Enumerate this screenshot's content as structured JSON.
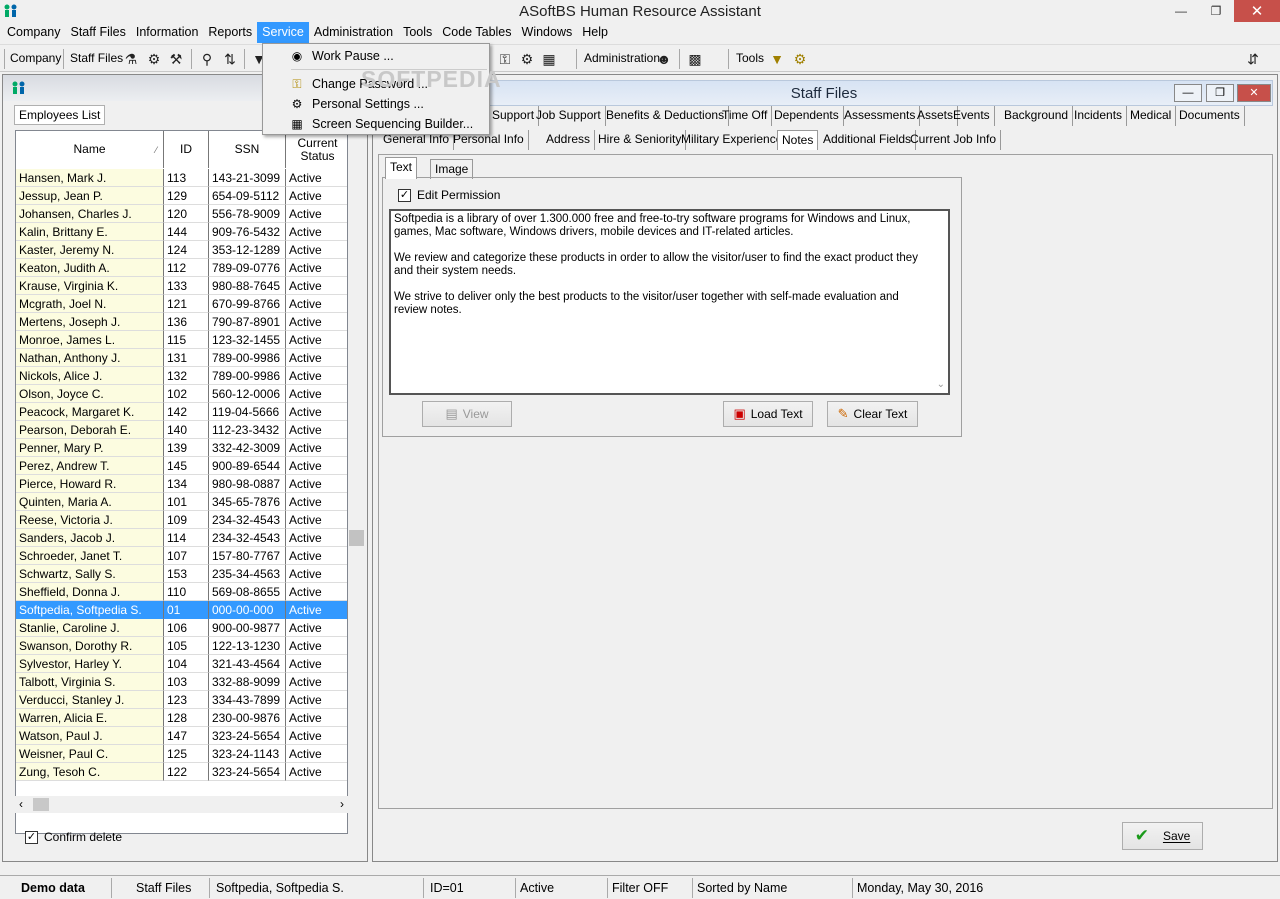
{
  "app": {
    "title": "ASoftBS Human Resource Assistant"
  },
  "menu": {
    "items": [
      "Company",
      "Staff Files",
      "Information",
      "Reports",
      "Service",
      "Administration",
      "Tools",
      "Code Tables",
      "Windows",
      "Help"
    ],
    "active": "Service"
  },
  "service_menu": {
    "items": [
      {
        "label": "Work Pause ...",
        "icon": "lock-icon"
      },
      {
        "label": "Change Password ...",
        "icon": "key-icon"
      },
      {
        "label": "Personal Settings ...",
        "icon": "settings-icon"
      },
      {
        "label": "Screen Sequencing Builder...",
        "icon": "sequence-icon"
      }
    ],
    "watermark": "SOFTPEDIA"
  },
  "toolbar": {
    "company": "Company",
    "staff_files": "Staff Files",
    "administration": "Administration",
    "tools": "Tools"
  },
  "left": {
    "tab": "Employees List",
    "columns": [
      "Name",
      "ID",
      "SSN",
      "Current Status"
    ],
    "confirm_delete": "Confirm delete",
    "confirm_checked": true,
    "selected_row": 24,
    "rows": [
      [
        "Hansen, Mark J.",
        "113",
        "143-21-3099",
        "Active"
      ],
      [
        "Jessup, Jean P.",
        "129",
        "654-09-5112",
        "Active"
      ],
      [
        "Johansen, Charles J.",
        "120",
        "556-78-9009",
        "Active"
      ],
      [
        "Kalin, Brittany E.",
        "144",
        "909-76-5432",
        "Active"
      ],
      [
        "Kaster, Jeremy N.",
        "124",
        "353-12-1289",
        "Active"
      ],
      [
        "Keaton, Judith A.",
        "112",
        "789-09-0776",
        "Active"
      ],
      [
        "Krause, Virginia K.",
        "133",
        "980-88-7645",
        "Active"
      ],
      [
        "Mcgrath, Joel N.",
        "121",
        "670-99-8766",
        "Active"
      ],
      [
        "Mertens, Joseph J.",
        "136",
        "790-87-8901",
        "Active"
      ],
      [
        "Monroe, James L.",
        "115",
        "123-32-1455",
        "Active"
      ],
      [
        "Nathan, Anthony J.",
        "131",
        "789-00-9986",
        "Active"
      ],
      [
        "Nickols, Alice J.",
        "132",
        "789-00-9986",
        "Active"
      ],
      [
        "Olson, Joyce C.",
        "102",
        "560-12-0006",
        "Active"
      ],
      [
        "Peacock, Margaret K.",
        "142",
        "119-04-5666",
        "Active"
      ],
      [
        "Pearson, Deborah E.",
        "140",
        "112-23-3432",
        "Active"
      ],
      [
        "Penner, Mary P.",
        "139",
        "332-42-3009",
        "Active"
      ],
      [
        "Perez, Andrew T.",
        "145",
        "900-89-6544",
        "Active"
      ],
      [
        "Pierce, Howard R.",
        "134",
        "980-98-0887",
        "Active"
      ],
      [
        "Quinten, Maria A.",
        "101",
        "345-65-7876",
        "Active"
      ],
      [
        "Reese, Victoria J.",
        "109",
        "234-32-4543",
        "Active"
      ],
      [
        "Sanders, Jacob J.",
        "114",
        "234-32-4543",
        "Active"
      ],
      [
        "Schroeder, Janet T.",
        "107",
        "157-80-7767",
        "Active"
      ],
      [
        "Schwartz, Sally S.",
        "153",
        "235-34-4563",
        "Active"
      ],
      [
        "Sheffield, Donna J.",
        "110",
        "569-08-8655",
        "Active"
      ],
      [
        "Softpedia, Softpedia S.",
        "01",
        "000-00-000",
        "Active"
      ],
      [
        "Stanlie, Caroline J.",
        "106",
        "900-00-9877",
        "Active"
      ],
      [
        "Swanson, Dorothy R.",
        "105",
        "122-13-1230",
        "Active"
      ],
      [
        "Sylvestor, Harley Y.",
        "104",
        "321-43-4564",
        "Active"
      ],
      [
        "Talbott, Virginia S.",
        "103",
        "332-88-9099",
        "Active"
      ],
      [
        "Verducci, Stanley J.",
        "123",
        "334-43-7899",
        "Active"
      ],
      [
        "Warren, Alicia E.",
        "128",
        "230-00-9876",
        "Active"
      ],
      [
        "Watson, Paul J.",
        "147",
        "323-24-5654",
        "Active"
      ],
      [
        "Weisner, Paul C.",
        "125",
        "323-24-1143",
        "Active"
      ],
      [
        "Zung, Tesoh C.",
        "122",
        "323-24-5654",
        "Active"
      ]
    ]
  },
  "staff": {
    "title": "Staff Files",
    "tabs_row1": [
      "Support",
      "Job Support",
      "Benefits & Deductions",
      "Time Off",
      "Dependents",
      "Assessments",
      "Assets",
      "Events",
      "Background",
      "Incidents",
      "Medical",
      "Documents"
    ],
    "tabs_row2": [
      "General Info",
      "Personal Info",
      "Address",
      "Hire & Seniority",
      "Military Experience",
      "Notes",
      "Additional Fields",
      "Current Job Info"
    ],
    "active_tab": "Notes",
    "subtabs": [
      "Text",
      "Image"
    ],
    "edit_permission": "Edit Permission",
    "edit_checked": true,
    "notes": [
      "Softpedia is a library of over 1.300.000 free and free-to-try software programs for Windows and Linux, games, Mac software, Windows drivers, mobile devices and IT-related articles.",
      "We review and categorize these products in order to allow the visitor/user to find the exact product they and their system needs.",
      "We strive to deliver only the best products to the visitor/user together with self-made evaluation and review notes."
    ],
    "buttons": {
      "view": "View",
      "load": "Load Text",
      "clear": "Clear Text",
      "save": "Save"
    }
  },
  "status": {
    "mode": "Demo data",
    "module": "Staff Files",
    "employee": "Softpedia, Softpedia S.",
    "id": "ID=01",
    "state": "Active",
    "filter": "Filter OFF",
    "sort": "Sorted by Name",
    "date": "Monday, May 30, 2016"
  }
}
